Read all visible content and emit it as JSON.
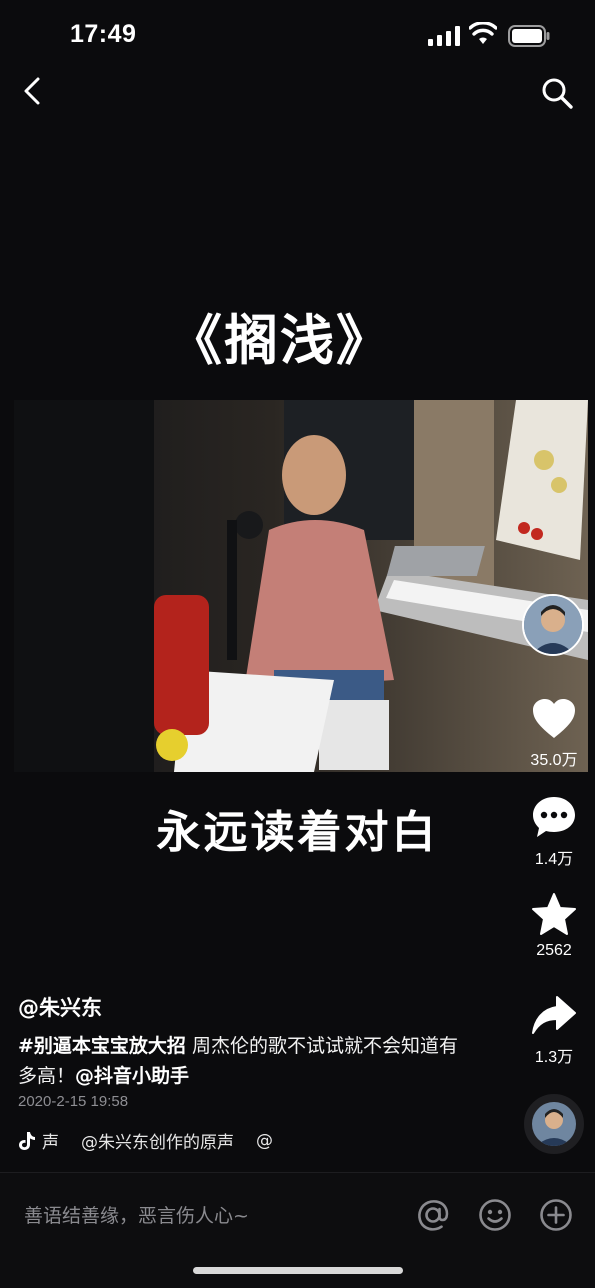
{
  "status_bar": {
    "time": "17:49"
  },
  "video": {
    "title": "《搁浅》",
    "subtitle": "永远读着对白"
  },
  "actions": {
    "likes": "35.0万",
    "comments": "1.4万",
    "favorites": "2562",
    "shares": "1.3万"
  },
  "post": {
    "username": "@朱兴东",
    "hashtag": "#别逼本宝宝放大招",
    "description": " 周杰伦的歌不试试就不会知道有多高！",
    "mention": "@抖音小助手",
    "date": "2020-2-15 19:58"
  },
  "music": {
    "label": "声",
    "track": "@朱兴东创作的原声",
    "extra": "@"
  },
  "comment_bar": {
    "placeholder": "善语结善缘，恶言伤人心~"
  },
  "colors": {
    "background": "#0b0b0d",
    "secondary_text": "#8e8e93"
  },
  "icons": [
    "back-icon",
    "search-icon",
    "heart-icon",
    "comment-icon",
    "star-icon",
    "share-icon",
    "tiktok-music-icon",
    "at-icon",
    "emoji-icon",
    "plus-icon"
  ]
}
